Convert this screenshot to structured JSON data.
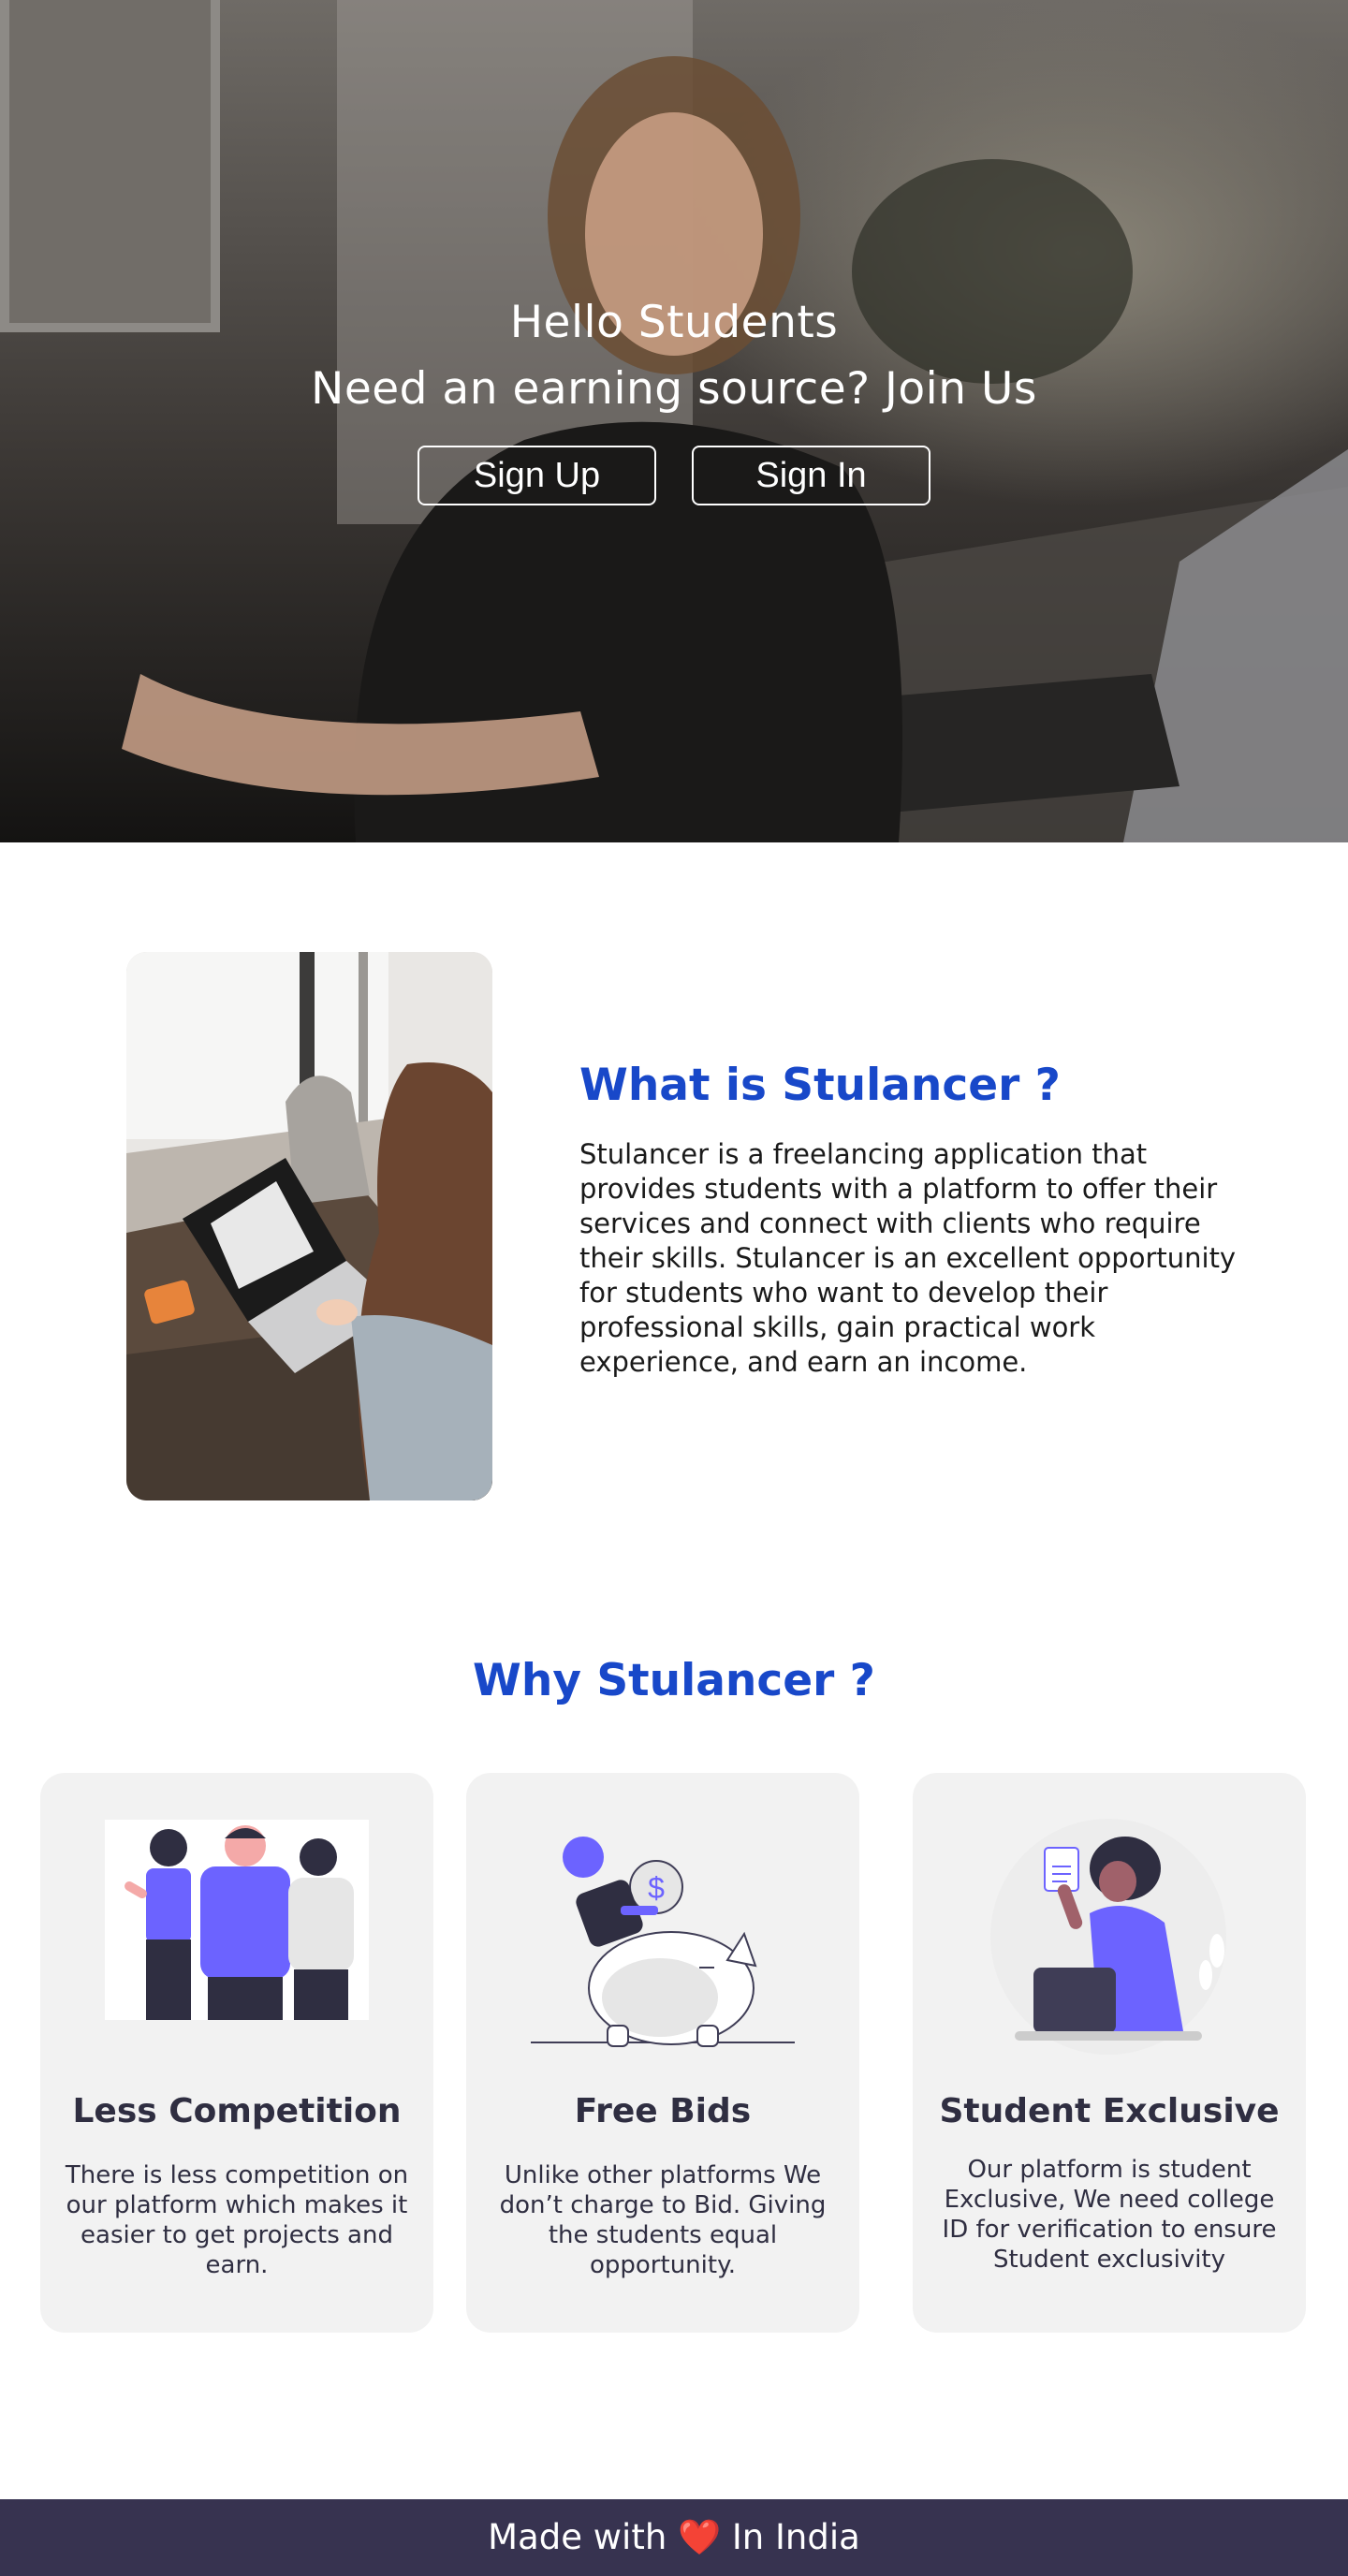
{
  "hero": {
    "title": "Hello Students",
    "subtitle": "Need an earning source? Join Us",
    "signup_label": "Sign Up",
    "signin_label": "Sign In"
  },
  "about": {
    "heading": "What is Stulancer ?",
    "body": "Stulancer is a freelancing application that provides students with a platform to offer their services and connect with clients who require their skills. Stulancer is an excellent opportunity for students who want to develop their professional skills, gain practical work experience, and earn an income."
  },
  "why": {
    "heading": "Why Stulancer ?",
    "cards": [
      {
        "title": "Less Competition",
        "text": "There is less competition on our platform which makes it easier to get projects and earn.",
        "icon": "group-of-people-illustration"
      },
      {
        "title": "Free Bids",
        "text": "Unlike other platforms We don’t charge to Bid. Giving the students equal opportunity.",
        "icon": "piggy-bank-illustration"
      },
      {
        "title": "Student Exclusive",
        "text": "Our platform is student Exclusive, We need college ID for verification to ensure Student exclusivity",
        "icon": "student-with-laptop-illustration"
      }
    ]
  },
  "footer": {
    "prefix": "Made with",
    "heart": "❤️",
    "suffix": "In India"
  },
  "colors": {
    "accent": "#1848c9",
    "illustration_purple": "#6c63ff",
    "footer_bg": "#373350",
    "card_bg": "#f2f2f2"
  }
}
